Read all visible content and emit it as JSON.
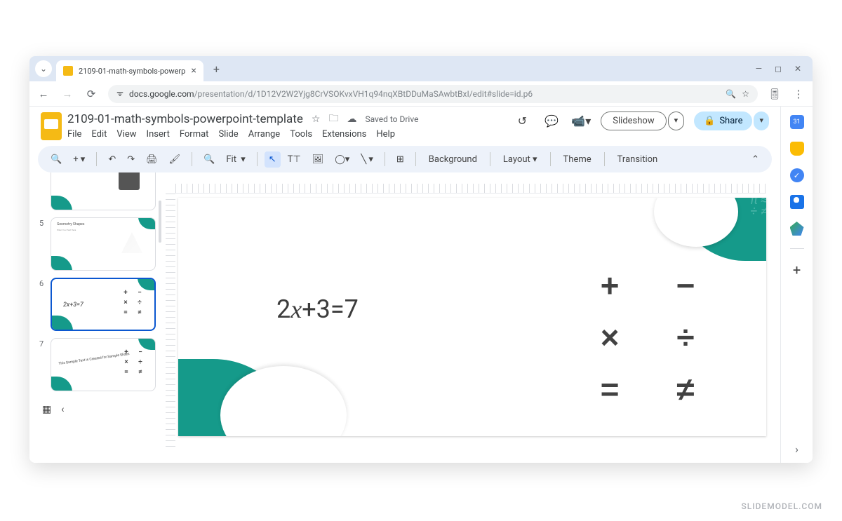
{
  "browser": {
    "tab_title": "2109-01-math-symbols-powerp",
    "url_host": "docs.google.com",
    "url_path": "/presentation/d/1D12V2W2Yjg8CrVSOKvxVH1q94nqXBtDDuMaSAwbtBxI/edit#slide=id.p6"
  },
  "doc": {
    "title": "2109-01-math-symbols-powerpoint-template",
    "saved_status": "Saved to Drive"
  },
  "menu": [
    "File",
    "Edit",
    "View",
    "Insert",
    "Format",
    "Slide",
    "Arrange",
    "Tools",
    "Extensions",
    "Help"
  ],
  "actions": {
    "slideshow": "Slideshow",
    "share": "Share"
  },
  "toolbar": {
    "zoom_label": "Fit",
    "background": "Background",
    "layout": "Layout",
    "theme": "Theme",
    "transition": "Transition"
  },
  "thumbnails": [
    {
      "num": "5",
      "title": "Geometry Shapes",
      "subtitle": "Enter Your Text Here"
    },
    {
      "num": "6",
      "equation": "2x+3=7",
      "symbols": [
        "+",
        "−",
        "×",
        "÷",
        "=",
        "≠"
      ]
    },
    {
      "num": "7",
      "curved_text": "This Sample Text is Created for Sample Slides",
      "symbols": [
        "+",
        "−",
        "×",
        "÷",
        "=",
        "≠"
      ]
    }
  ],
  "slide": {
    "equation_parts": {
      "a": "2",
      "x": "x",
      "rest": "+3=7"
    },
    "symbols": [
      "+",
      "−",
      "×",
      "÷",
      "=",
      "≠"
    ]
  },
  "watermark": "SLIDEMODEL.COM"
}
